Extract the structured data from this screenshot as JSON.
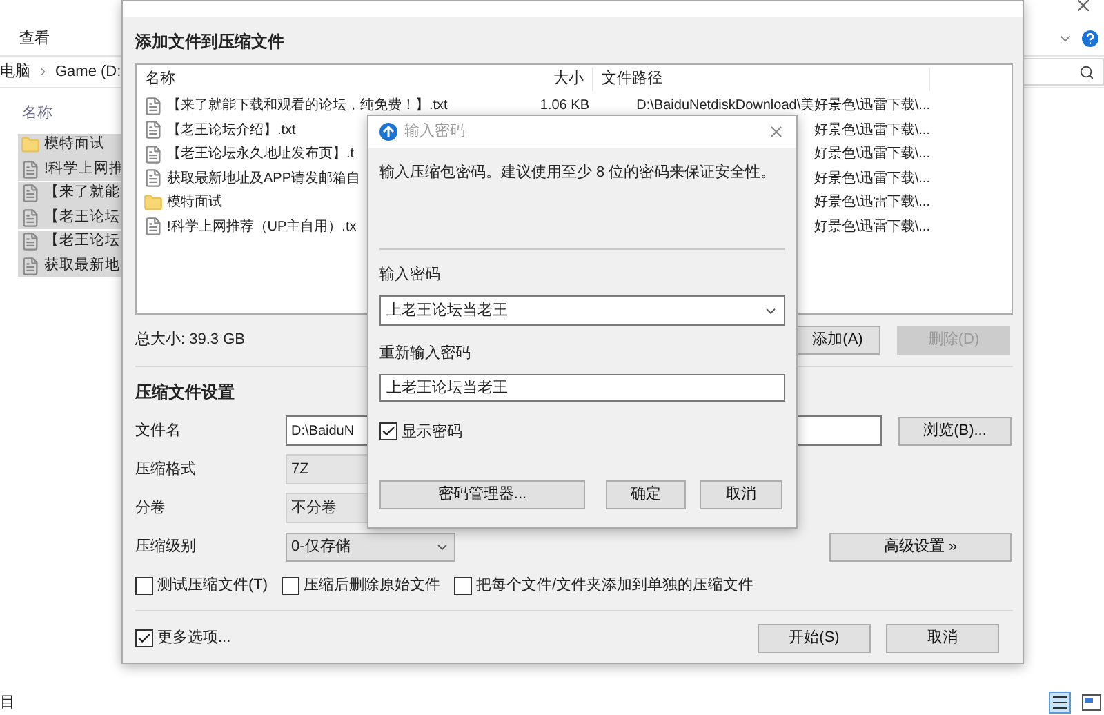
{
  "explorer": {
    "menu": "查看",
    "breadcrumb": [
      "电脑",
      "Game (D:"
    ],
    "column": "名称",
    "items": [
      {
        "kind": "folder",
        "name": "模特面试",
        "selected": true
      },
      {
        "kind": "file",
        "name": "!科学上网推",
        "selected": true
      },
      {
        "kind": "file",
        "name": "【来了就能",
        "selected": true
      },
      {
        "kind": "file",
        "name": "【老王论坛",
        "selected": true
      },
      {
        "kind": "file",
        "name": "【老王论坛",
        "selected": true
      },
      {
        "kind": "file",
        "name": "获取最新地",
        "selected": true
      }
    ],
    "status": "目"
  },
  "archive_dialog": {
    "heading": "添加文件到压缩文件",
    "columns": [
      "名称",
      "大小",
      "文件路径"
    ],
    "files": [
      {
        "kind": "file",
        "name": "【来了就能下载和观看的论坛，纯免费！】.txt",
        "size": "1.06 KB",
        "path": "D:\\BaiduNetdiskDownload\\美好景色\\迅雷下载\\..."
      },
      {
        "kind": "file",
        "name": "【老王论坛介绍】.txt",
        "path": "好景色\\迅雷下载\\..."
      },
      {
        "kind": "file",
        "name": "【老王论坛永久地址发布页】.t",
        "path": "好景色\\迅雷下载\\..."
      },
      {
        "kind": "file",
        "name": "获取最新地址及APP请发邮箱自",
        "path": "好景色\\迅雷下载\\..."
      },
      {
        "kind": "folder",
        "name": "模特面试",
        "path": "好景色\\迅雷下载\\..."
      },
      {
        "kind": "file",
        "name": "!科学上网推荐（UP主自用）.tx",
        "path": "好景色\\迅雷下载\\..."
      }
    ],
    "total": "总大小: 39.3 GB",
    "list_buttons": [
      {
        "label": "添加(A)",
        "disabled": false
      },
      {
        "label": "删除(D)",
        "disabled": true
      }
    ],
    "settings_heading": "压缩文件设置",
    "fields": [
      {
        "kind": "input",
        "label": "文件名",
        "value": "D:\\BaiduN"
      },
      {
        "kind": "select",
        "label": "压缩格式",
        "value": "7Z"
      },
      {
        "kind": "select",
        "label": "分卷",
        "value": "不分卷"
      },
      {
        "kind": "dropdown",
        "label": "压缩级别",
        "value": "0-仅存储"
      }
    ],
    "browse_button": "浏览(B)...",
    "advanced_button": "高级设置 »",
    "options": [
      {
        "label": "测试压缩文件(T)",
        "checked": false
      },
      {
        "label": "压缩后删除原始文件",
        "checked": false
      },
      {
        "label": "把每个文件/文件夹添加到单独的压缩文件",
        "checked": false
      }
    ],
    "more_options": {
      "label": "更多选项...",
      "checked": true
    },
    "buttons": [
      "开始(S)",
      "取消"
    ]
  },
  "password_dialog": {
    "title": "输入密码",
    "message": "输入压缩包密码。建议使用至少 8 位的密码来保证安全性。",
    "password_label": "输入密码",
    "password": "上老王论坛当老王",
    "confirm_label": "重新输入密码",
    "confirm": "上老王论坛当老王",
    "show_password": {
      "label": "显示密码",
      "checked": true
    },
    "manager_button": "密码管理器...",
    "buttons": [
      "确定",
      "取消"
    ]
  }
}
